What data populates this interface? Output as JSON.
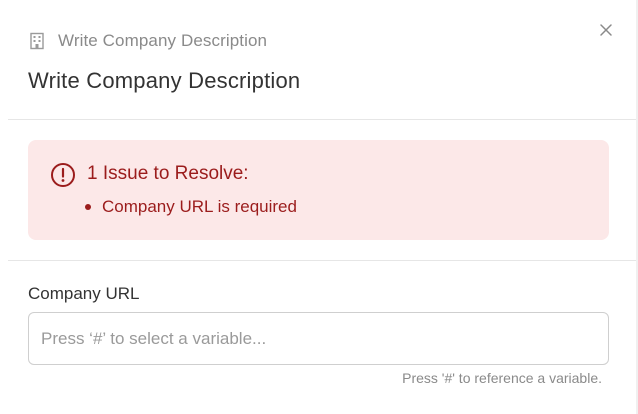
{
  "header": {
    "breadcrumb_icon": "building-icon",
    "breadcrumb_text": "Write Company Description",
    "close_icon": "close-icon"
  },
  "title": "Write Company Description",
  "alert": {
    "icon": "alert-circle-icon",
    "title": "1 Issue to Resolve:",
    "items": [
      "Company URL is required"
    ],
    "color": "#9b1c1c",
    "background": "#fce8e8"
  },
  "field": {
    "label": "Company URL",
    "value": "",
    "placeholder": "Press ‘#’ to select a variable...",
    "hint": "Press '#' to reference a variable."
  }
}
